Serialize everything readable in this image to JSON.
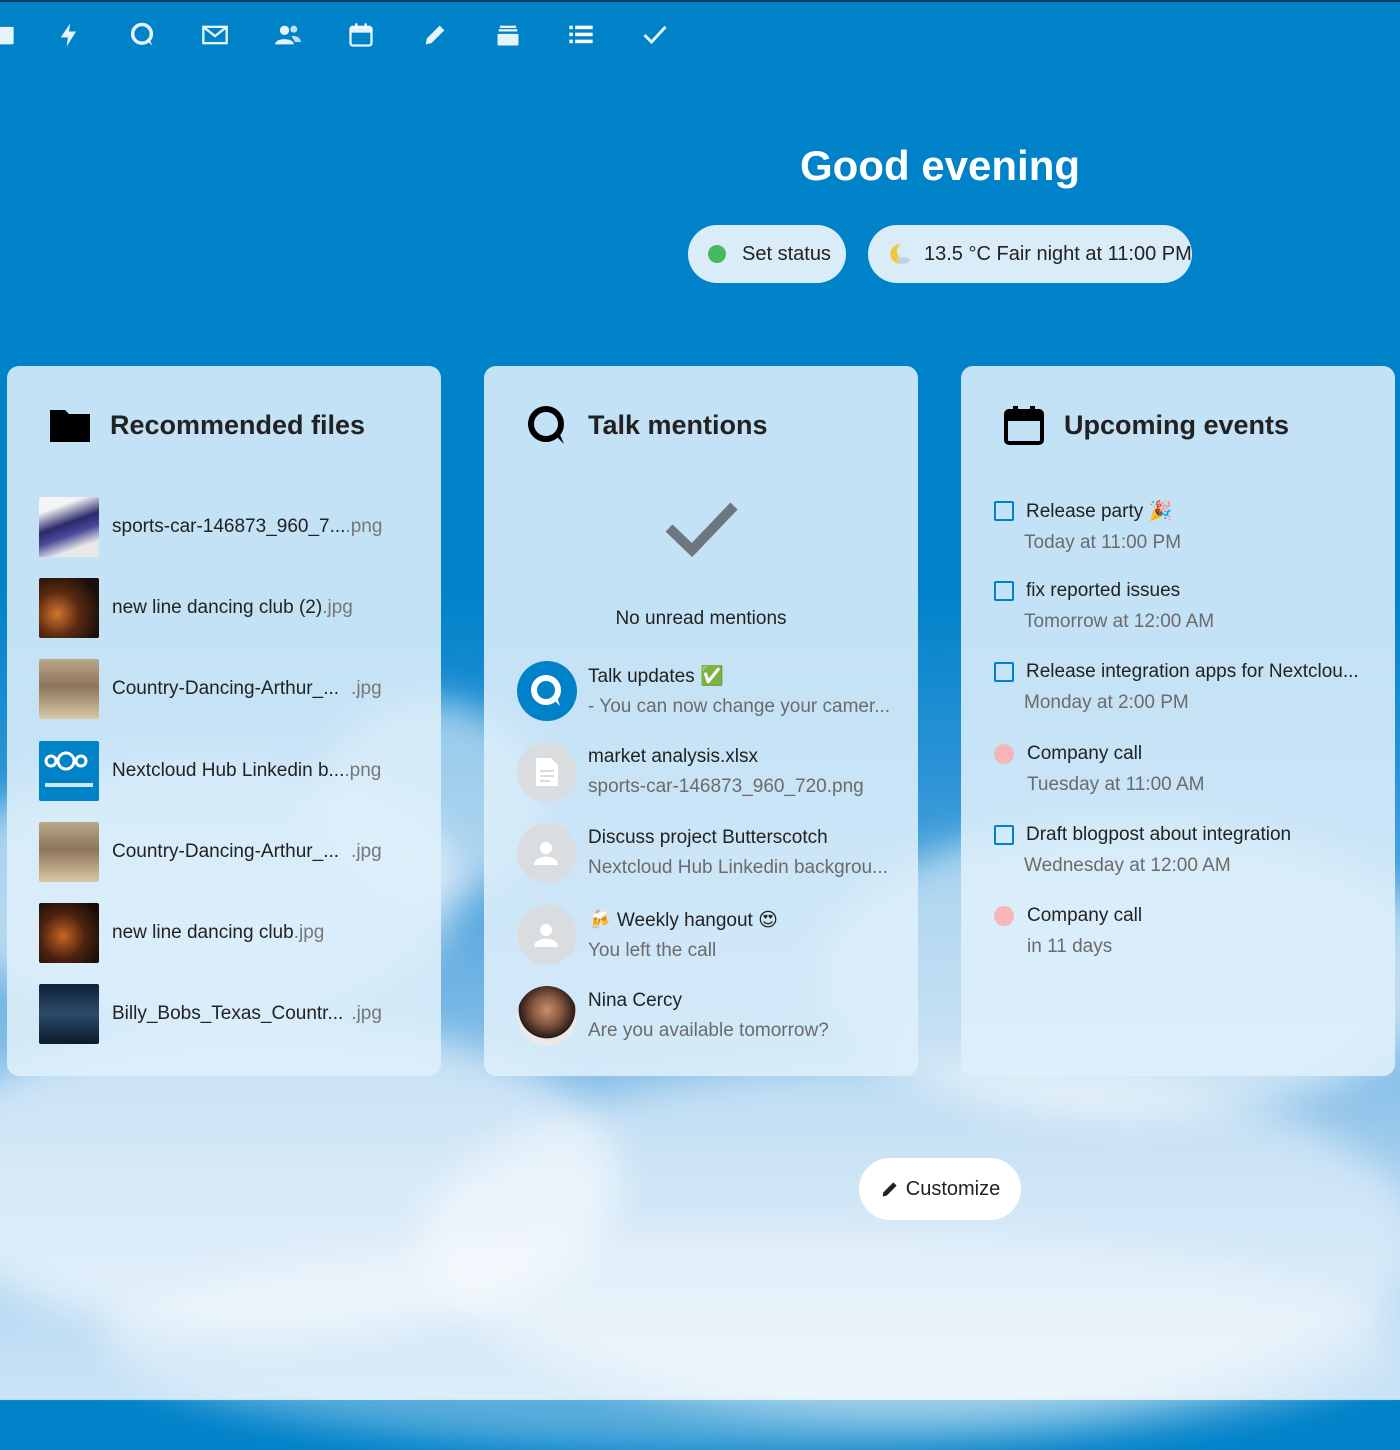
{
  "nav": {
    "icons": [
      "files-icon",
      "activity-icon",
      "talk-icon",
      "mail-icon",
      "contacts-icon",
      "calendar-icon",
      "notes-icon",
      "deck-icon",
      "tasks-icon",
      "check-icon"
    ]
  },
  "greeting": "Good evening",
  "status": {
    "label": "Set status",
    "color": "#46ba61"
  },
  "weather": {
    "label": "13.5 °C Fair night at 11:00 PM"
  },
  "recommended_files": {
    "title": "Recommended files",
    "items": [
      {
        "name": "sports-car-146873_960_7...",
        "ext": ".png"
      },
      {
        "name": "new line dancing club (2)",
        "ext": ".jpg"
      },
      {
        "name": "Country-Dancing-Arthur_...",
        "ext": ".jpg"
      },
      {
        "name": "Nextcloud Hub Linkedin b...",
        "ext": ".png"
      },
      {
        "name": "Country-Dancing-Arthur_...",
        "ext": ".jpg"
      },
      {
        "name": "new line dancing club",
        "ext": ".jpg"
      },
      {
        "name": "Billy_Bobs_Texas_Countr...",
        "ext": ".jpg"
      }
    ]
  },
  "talk_mentions": {
    "title": "Talk mentions",
    "empty_text": "No unread mentions",
    "items": [
      {
        "title": "Talk updates ✅",
        "sub": "- You can now change your camer..."
      },
      {
        "title": "market analysis.xlsx",
        "sub": "sports-car-146873_960_720.png"
      },
      {
        "title": "Discuss project Butterscotch",
        "sub": "Nextcloud Hub Linkedin backgrou..."
      },
      {
        "title": "🍻 Weekly hangout 😍",
        "sub": "You left the call"
      },
      {
        "title": "Nina Cercy",
        "sub": "Are you available tomorrow?"
      }
    ]
  },
  "upcoming_events": {
    "title": "Upcoming events",
    "items": [
      {
        "title": "Release party 🎉",
        "sub": "Today at 11:00 PM",
        "kind": "task"
      },
      {
        "title": "fix reported issues",
        "sub": "Tomorrow at 12:00 AM",
        "kind": "task"
      },
      {
        "title": "Release integration apps for Nextclou...",
        "sub": "Monday at 2:00 PM",
        "kind": "task"
      },
      {
        "title": "Company call",
        "sub": "Tuesday at 11:00 AM",
        "kind": "event"
      },
      {
        "title": "Draft blogpost about integration",
        "sub": "Wednesday at 12:00 AM",
        "kind": "task"
      },
      {
        "title": "Company call",
        "sub": "in 11 days",
        "kind": "event"
      }
    ]
  },
  "customize": {
    "label": "Customize"
  },
  "colors": {
    "brand": "#0082c9",
    "event_dot": "#f4b6b8",
    "status_online": "#46ba61"
  }
}
